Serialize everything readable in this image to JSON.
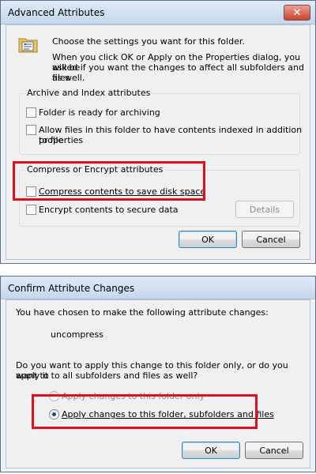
{
  "advanced_attributes": {
    "title": "Advanced Attributes",
    "close_symbol": "✕",
    "intro_line1": "Choose the settings you want for this folder.",
    "intro_line2": "When you click OK or Apply on the Properties dialog, you will be",
    "intro_line3": "asked if you want the changes to affect all subfolders and files",
    "intro_line4": "as well.",
    "archive_group_label": "Archive and Index attributes",
    "archive_label": "Folder is ready for archiving",
    "index_label_line1": "Allow files in this folder to have contents indexed in addition to file",
    "index_label_line2": "properties",
    "compress_group_label": "Compress or Encrypt attributes",
    "compress_label": "Compress contents to save disk space",
    "encrypt_label": "Encrypt contents to secure data",
    "details_button": "Details",
    "ok_button": "OK",
    "cancel_button": "Cancel"
  },
  "confirm_changes": {
    "title": "Confirm Attribute Changes",
    "intro": "You have chosen to make the following attribute changes:",
    "change": "uncompress",
    "question_line1": "Do you want to apply this change to this folder only, or do you want to",
    "question_line2": "apply it to all subfolders and files as well?",
    "option_folder_only": "Apply changes to this folder only",
    "option_all": "Apply changes to this folder, subfolders and files",
    "selected_option": "option_all",
    "ok_button": "OK",
    "cancel_button": "Cancel"
  },
  "colors": {
    "highlight": "#e0101a",
    "title_bar": "#c6d7ec"
  }
}
